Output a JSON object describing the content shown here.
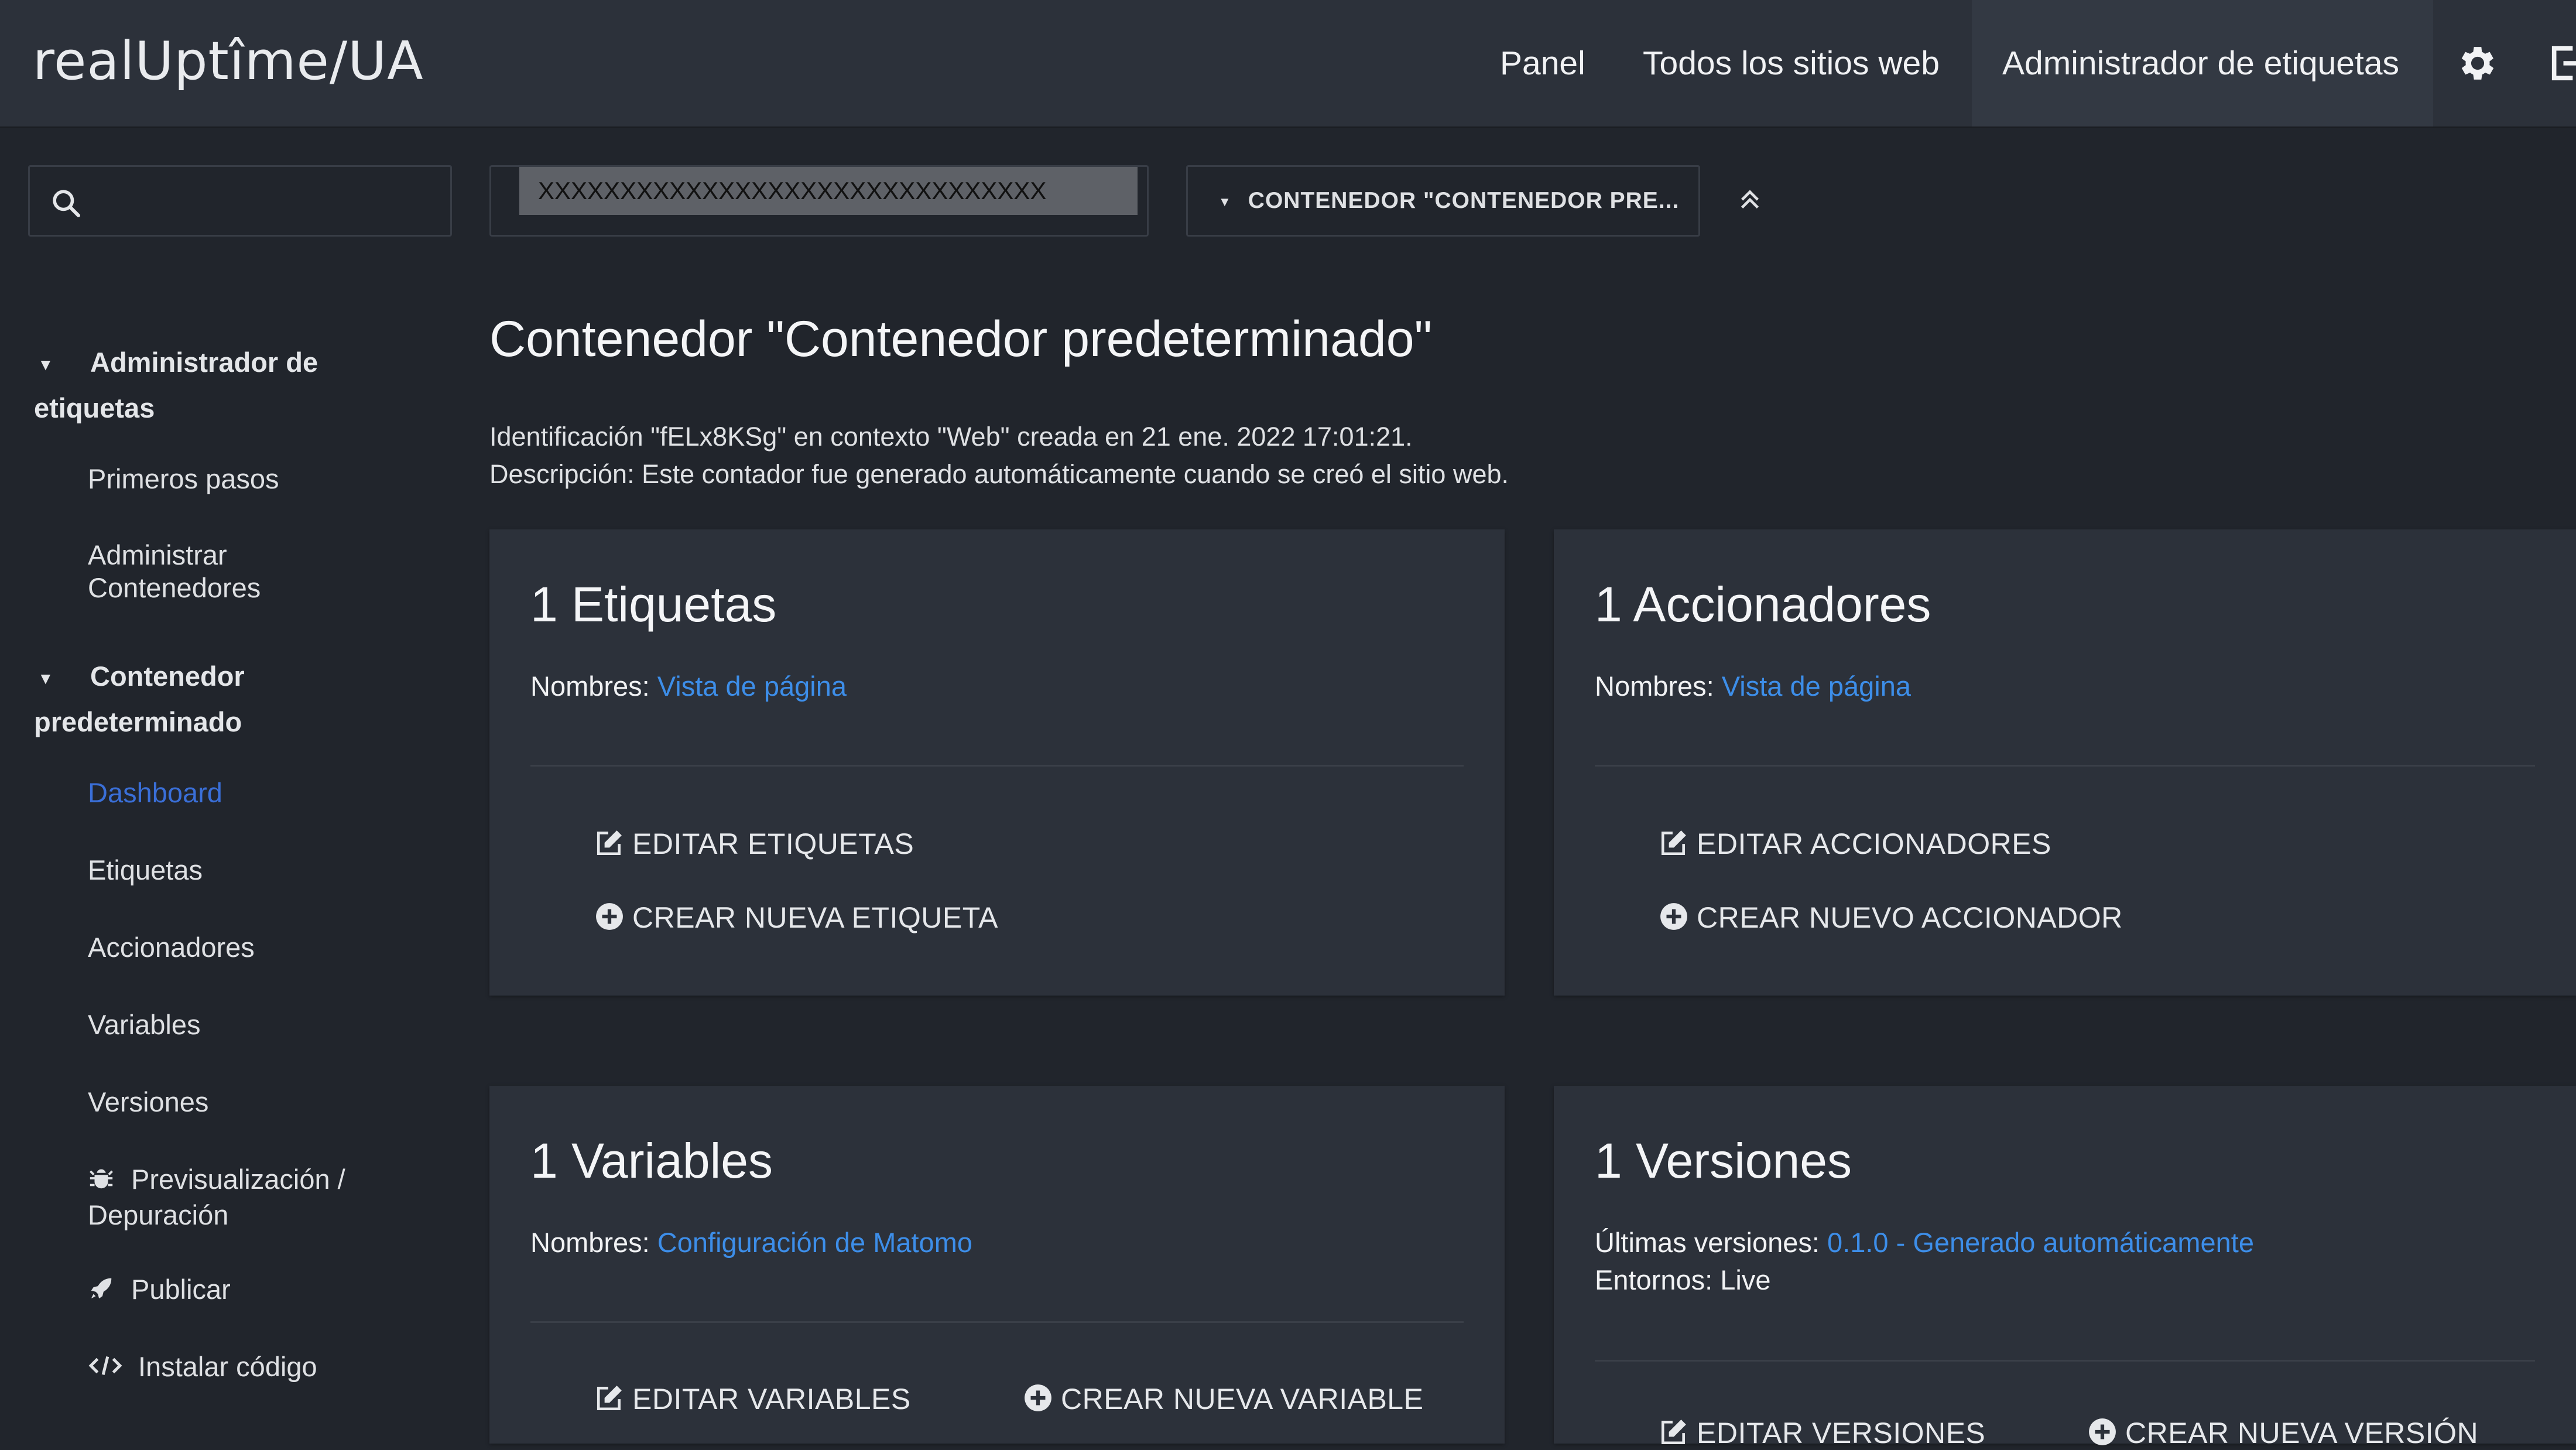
{
  "topbar": {
    "logo": "realUptîme/UA",
    "nav": [
      "Panel",
      "Todos los sitios web",
      "Administrador de etiquetas"
    ],
    "active_nav": "Administrador de etiquetas",
    "icons": [
      "gear-icon",
      "logout-icon"
    ]
  },
  "sidebar": {
    "search": {
      "value": "",
      "placeholder": ""
    },
    "section1": "Administrador de etiquetas",
    "section1_items": [
      "Primeros pasos",
      "Administrar Contenedores"
    ],
    "section2": "Contenedor predeterminado",
    "section2_items": [
      {
        "label": "Dashboard",
        "active": true
      },
      {
        "label": "Etiquetas"
      },
      {
        "label": "Accionadores"
      },
      {
        "label": "Variables"
      },
      {
        "label": "Versiones"
      },
      {
        "label": "Previsualización / Depuración",
        "icon": "bug-icon"
      },
      {
        "label": "Publicar",
        "icon": "rocket-icon"
      },
      {
        "label": "Instalar código",
        "icon": "code-icon"
      }
    ]
  },
  "selectors": {
    "site_value": "XXXXXXXXXXXXXXXXXXXXXXXXXXXXXXX",
    "container_label": "CONTENEDOR \"CONTENEDOR PRE..."
  },
  "main": {
    "title": "Contenedor \"Contenedor predeterminado\"",
    "id_line": "Identificación \"fELx8KSg\" en contexto \"Web\" creada en 21 ene. 2022 17:01:21.",
    "desc_line": "Descripción: Este contador fue generado automáticamente cuando se creó el sitio web."
  },
  "cards": {
    "tags": {
      "title": "1 Etiquetas",
      "names_label": "Nombres:",
      "names_link": "Vista de página",
      "action1": "EDITAR ETIQUETAS",
      "action2": "CREAR NUEVA ETIQUETA"
    },
    "triggers": {
      "title": "1 Accionadores",
      "names_label": "Nombres:",
      "names_link": "Vista de página",
      "action1": "EDITAR ACCIONADORES",
      "action2": "CREAR NUEVO ACCIONADOR"
    },
    "variables": {
      "title": "1 Variables",
      "names_label": "Nombres:",
      "names_link": "Configuración de Matomo",
      "action1": "EDITAR VARIABLES",
      "action2": "CREAR NUEVA VARIABLE"
    },
    "versions": {
      "title": "1 Versiones",
      "latest_label": "Últimas versiones:",
      "latest_link": "0.1.0 - Generado automáticamente",
      "env_label": "Entornos:",
      "env_value": "Live",
      "action1": "EDITAR VERSIONES",
      "action2": "CREAR NUEVA VERSIÓN"
    }
  },
  "colors": {
    "background": "#21252c",
    "topbar": "#2c313a",
    "card": "#2c313a",
    "link": "#3d8ee9",
    "active_sidebar": "#3a6fd8"
  }
}
